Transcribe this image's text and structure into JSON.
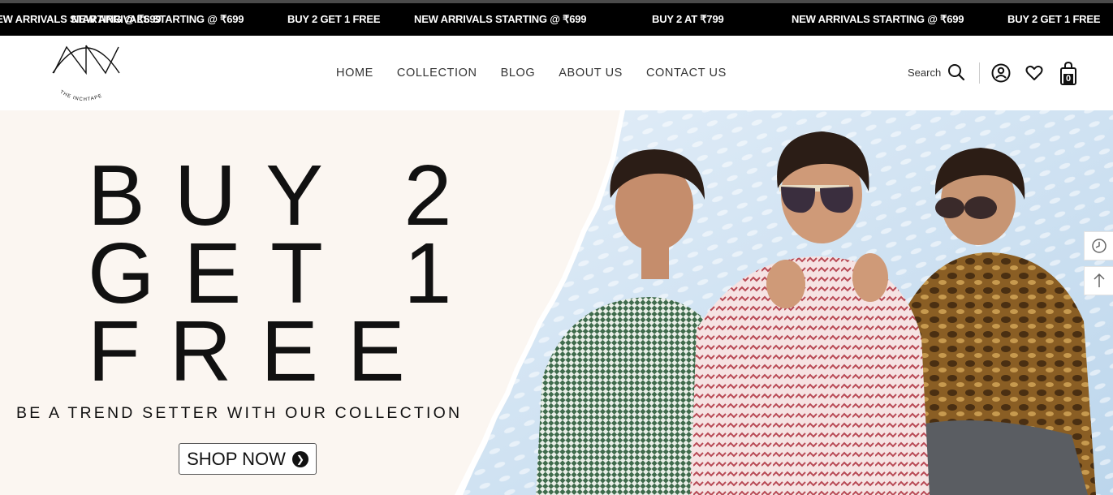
{
  "ticker": {
    "items": [
      "NEW ARRIVALS STARTING @ ₹699",
      "BUY 2 GET 1 FREE",
      "NEW ARRIVALS STARTING @ ₹699",
      "BUY 2 AT ₹799",
      "NEW ARRIVALS STARTING @ ₹699",
      "BUY 2 GET 1 FREE"
    ]
  },
  "header": {
    "logo_text": "THE INCHTAPE",
    "nav": [
      "HOME",
      "COLLECTION",
      "BLOG",
      "ABOUT US",
      "CONTACT US"
    ],
    "search_label": "Search",
    "cart_count": "0",
    "icons": [
      "search-icon",
      "account-icon",
      "wishlist-heart-icon",
      "cart-bag-icon"
    ]
  },
  "hero": {
    "headline": [
      "BUY 2",
      "GET 1",
      "FREE"
    ],
    "tagline": "BE A TREND SETTER WITH OUR COLLECTION",
    "cta_label": "SHOP NOW",
    "bg_left": "#fbf6f1",
    "bg_right": "#cfe3f3"
  },
  "side_buttons": [
    "recently-viewed-icon",
    "back-to-top-icon"
  ]
}
